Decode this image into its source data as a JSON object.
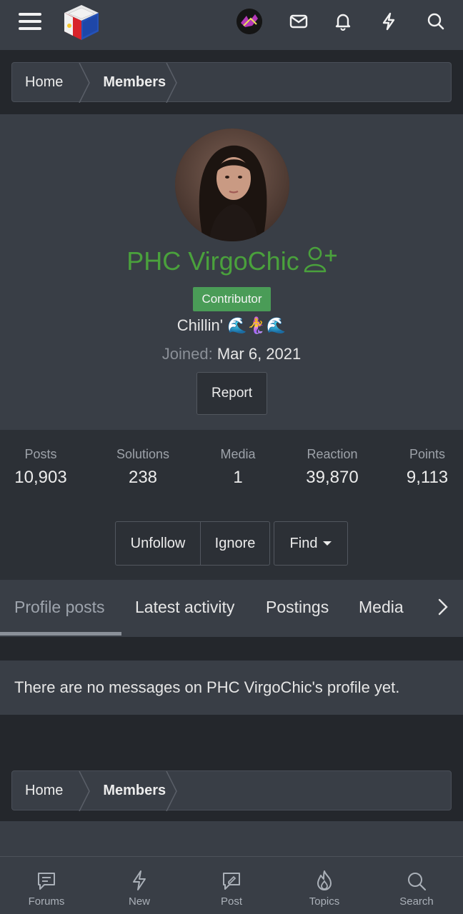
{
  "header": {
    "menu_icon": "hamburger-icon",
    "logo_icon": "flag-cube-logo",
    "icons": [
      "user-avatar",
      "mail-icon",
      "bell-icon",
      "lightning-icon",
      "search-icon"
    ]
  },
  "breadcrumb": {
    "home": "Home",
    "members": "Members"
  },
  "profile": {
    "username": "PHC VirgoChic",
    "badge": "Contributor",
    "status": "Chillin' 🌊🧜‍♀️🌊",
    "joined_label": "Joined:",
    "joined_date": "Mar 6, 2021",
    "report_label": "Report"
  },
  "stats": [
    {
      "label": "Posts",
      "value": "10,903"
    },
    {
      "label": "Solutions",
      "value": "238"
    },
    {
      "label": "Media",
      "value": "1"
    },
    {
      "label": "Reaction",
      "value": "39,870"
    },
    {
      "label": "Points",
      "value": "9,113"
    }
  ],
  "actions": {
    "unfollow": "Unfollow",
    "ignore": "Ignore",
    "find": "Find"
  },
  "tabs": [
    "Profile posts",
    "Latest activity",
    "Postings",
    "Media"
  ],
  "empty_message": "There are no messages on PHC VirgoChic's profile yet.",
  "bottom_nav": [
    {
      "label": "Forums",
      "icon": "forums-icon"
    },
    {
      "label": "New",
      "icon": "lightning-icon"
    },
    {
      "label": "Post",
      "icon": "post-icon"
    },
    {
      "label": "Topics",
      "icon": "fire-icon"
    },
    {
      "label": "Search",
      "icon": "search-icon"
    }
  ],
  "colors": {
    "accent_green": "#4aa13c",
    "badge_green": "#4a9c57",
    "panel": "#393e46",
    "background": "#24272c"
  }
}
